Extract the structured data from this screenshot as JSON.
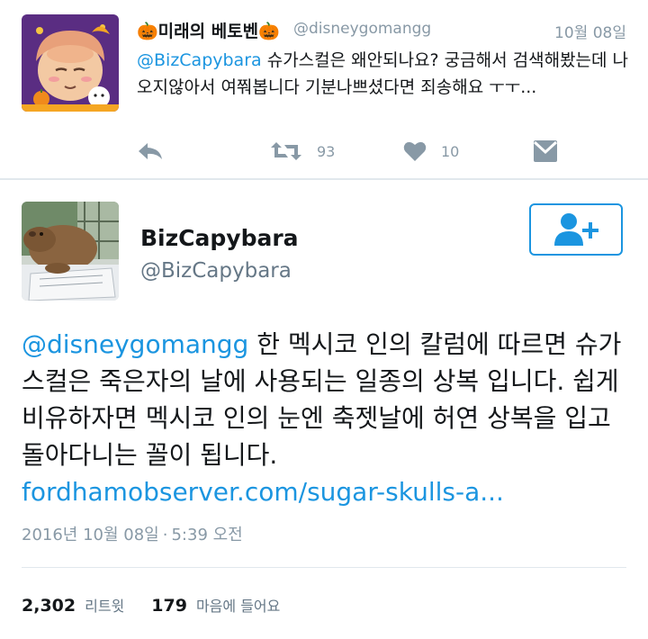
{
  "reply_tweet": {
    "display_name": "🎃미래의 베토벤🎃",
    "handle": "@disneygomangg",
    "date": "10월 08일",
    "mention": "@BizCapybara",
    "text": " 슈가스컬은 왜안되나요? 궁금해서 검색해봤는데 나오지않아서 여쭤봅니다 기분나쁘셨다면 죄송해요 ㅜㅜ...",
    "actions": {
      "reply_icon": "reply-icon",
      "retweet_icon": "retweet-icon",
      "retweet_count": "93",
      "like_icon": "heart-icon",
      "like_count": "10",
      "dm_icon": "envelope-icon"
    }
  },
  "main_tweet": {
    "display_name": "BizCapybara",
    "handle": "@BizCapybara",
    "follow_icon": "add-user-icon",
    "mention": "@disneygomangg",
    "text": " 한 멕시코 인의 칼럼에 따르면 슈가 스컬은 죽은자의 날에 사용되는 일종의 상복 입니다. 쉽게 비유하자면 멕시코 인의 눈엔 축젯날에 허연 상복을 입고 돌아다니는 꼴이 됩니다.",
    "link": "fordhamobserver.com/sugar-skulls-a...",
    "timestamp_date": "2016년 10월 08일",
    "timestamp_sep": "·",
    "timestamp_time": "5:39 오전",
    "retweets_count": "2,302",
    "retweets_label": "리트윗",
    "likes_count": "179",
    "likes_label": "마음에 들어요"
  },
  "colors": {
    "accent": "#1b95e0",
    "muted": "#8899a6",
    "text": "#14171a",
    "divider": "#e1e8ed"
  }
}
